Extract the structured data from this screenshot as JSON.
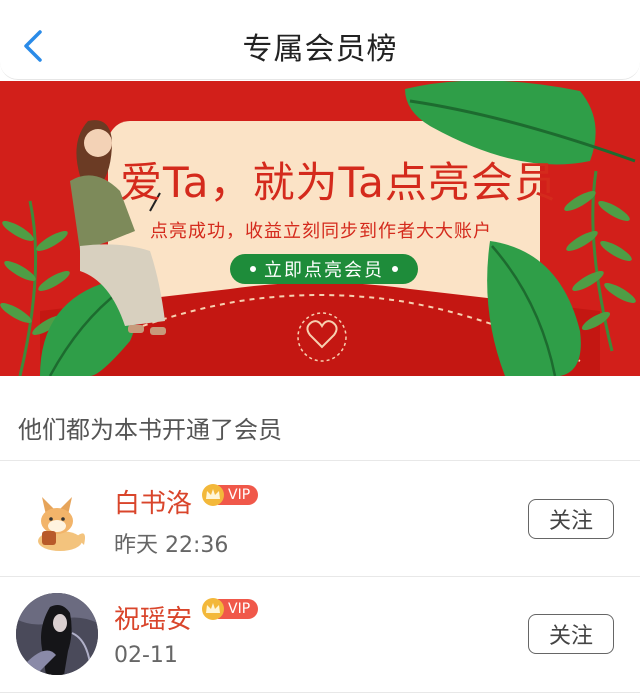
{
  "header": {
    "title": "专属会员榜"
  },
  "banner": {
    "headline": "爱Ta，就为Ta点亮会员",
    "subline": "点亮成功，收益立刻同步到作者大大账户",
    "cta_label": "立即点亮会员"
  },
  "section": {
    "title": "他们都为本书开通了会员"
  },
  "members": [
    {
      "name": "白书洛",
      "badge": "VIP",
      "time": "昨天 22:36",
      "follow_label": "关注"
    },
    {
      "name": "祝瑶安",
      "badge": "VIP",
      "time": "02-11",
      "follow_label": "关注"
    }
  ],
  "colors": {
    "accent_blue": "#2a8be8",
    "banner_red": "#d42a1c",
    "name_red": "#d9452b",
    "cta_green": "#1e8c3a",
    "vip_red": "#f0584a",
    "crown_gold": "#f3b83a"
  },
  "icons": [
    "back-arrow-icon",
    "crown-icon",
    "heart-seal-icon"
  ]
}
